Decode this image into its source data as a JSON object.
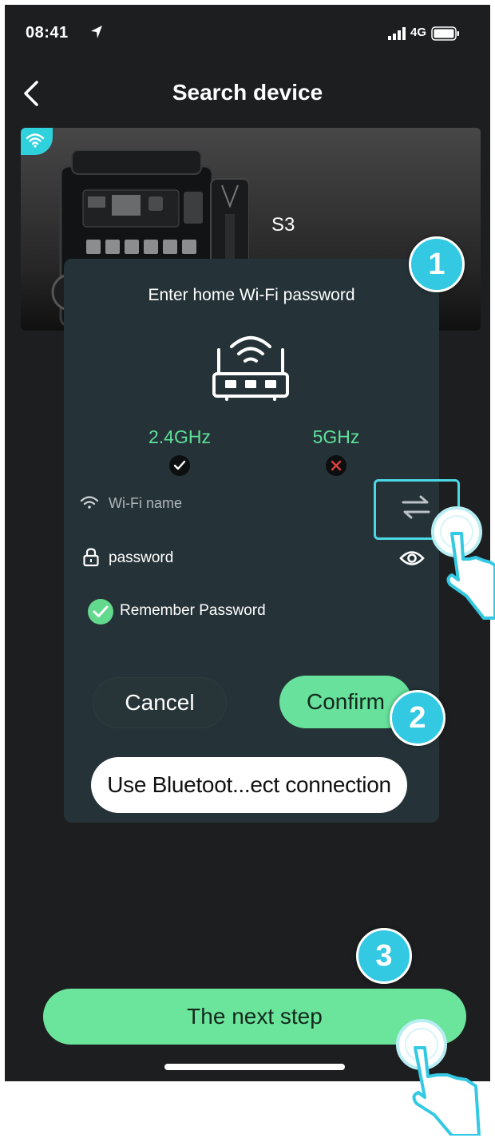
{
  "status_bar": {
    "time": "08:41",
    "network": "4G"
  },
  "header": {
    "title": "Search device"
  },
  "device": {
    "name": "S3"
  },
  "dialog": {
    "title": "Enter home Wi-Fi password",
    "bands": [
      {
        "label": "2.4GHz",
        "supported": true
      },
      {
        "label": "5GHz",
        "supported": false
      }
    ],
    "wifi_name_placeholder": "Wi-Fi name",
    "password_placeholder": "password",
    "remember_label": "Remember Password",
    "remember_checked": true,
    "cancel_label": "Cancel",
    "confirm_label": "Confirm",
    "bluetooth_label": "Use Bluetoot...ect connection"
  },
  "footer": {
    "next_label": "The next step"
  },
  "step_markers": [
    "1",
    "2",
    "3"
  ],
  "colors": {
    "accent_green": "#67e19b",
    "marker_blue": "#34c9e3",
    "dialog_bg": "#253338",
    "screen_bg": "#1d1e20"
  },
  "icons": [
    "location-arrow-icon",
    "signal-bars-icon",
    "battery-icon",
    "back-chevron-icon",
    "wifi-icon",
    "router-icon",
    "check-icon",
    "cross-icon",
    "lock-icon",
    "eye-icon",
    "swap-arrows-icon",
    "tap-hand-icon"
  ]
}
